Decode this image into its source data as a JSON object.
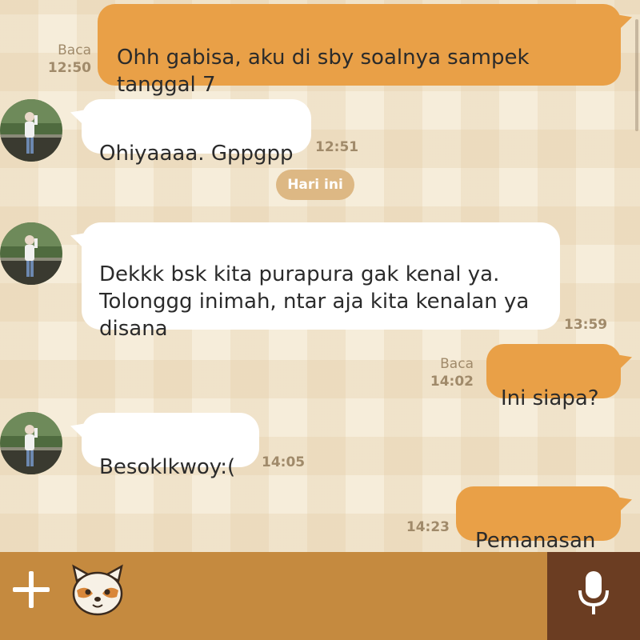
{
  "messages": [
    {
      "id": "m1",
      "direction": "outgoing",
      "text": "Ohh gabisa, aku di sby soalnya sampek\ntanggal 7",
      "read": "Baca",
      "time": "12:50"
    },
    {
      "id": "m2",
      "direction": "incoming",
      "text": "Ohiyaaaa. Gppgpp",
      "time": "12:51"
    },
    {
      "id": "m3",
      "direction": "incoming",
      "text": "Dekkk bsk kita purapura gak kenal ya.\nTolonggg inimah, ntar aja kita kenalan ya\ndisana",
      "time": "13:59"
    },
    {
      "id": "m4",
      "direction": "outgoing",
      "text": "Ini siapa?",
      "read": "Baca",
      "time": "14:02"
    },
    {
      "id": "m5",
      "direction": "incoming",
      "text": "Besoklkwoy:(",
      "time": "14:05"
    },
    {
      "id": "m6",
      "direction": "outgoing",
      "text": "Pemanasan",
      "time": "14:23"
    }
  ],
  "date_separator": "Hari ini",
  "icons": {
    "add": "plus-icon",
    "sticker": "raccoon-sticker-icon",
    "voice": "microphone-icon",
    "avatar": "contact-avatar"
  },
  "colors": {
    "outgoing_bubble": "#e9a047",
    "incoming_bubble": "#ffffff",
    "input_bar": "#c58a3f",
    "mic_button": "#6b3d22",
    "date_pill": "#ddb884",
    "chat_background": "#f6edda"
  }
}
